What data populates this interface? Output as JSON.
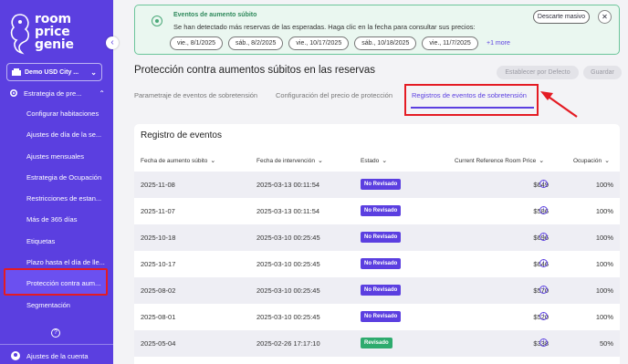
{
  "brand": {
    "logo_text": [
      "room",
      "price",
      "genie"
    ],
    "accent": "#5b3fe0",
    "highlight": "#e41b23"
  },
  "sidebar": {
    "hotel": "Demo USD City ...",
    "parent": "Estrategia de pre...",
    "items": [
      "Configurar habitaciones",
      "Ajustes de día de la se...",
      "Ajustes mensuales",
      "Estrategia de Ocupación",
      "Restricciones de estan...",
      "Más de 365 días",
      "Etiquetas",
      "Plazo hasta el día de lle...",
      "Protección contra aum...",
      "Segmentación"
    ],
    "help": "?",
    "account": "Ajustes de la cuenta"
  },
  "alert": {
    "title": "Eventos de aumento súbito",
    "text": "Se han detectado más reservas de las esperadas. Haga clic en la fecha para consultar sus precios:",
    "dates": [
      "vie., 8/1/2025",
      "sáb., 8/2/2025",
      "vie., 10/17/2025",
      "sáb., 10/18/2025",
      "vie., 11/7/2025"
    ],
    "more": "+1 more",
    "dismiss": "Descarte masivo",
    "close": "✕"
  },
  "header": {
    "title": "Protección contra aumentos súbitos en las reservas",
    "default_btn": "Establecer por Defecto",
    "save_btn": "Guardar"
  },
  "tabs": [
    "Parametraje de eventos de sobretensión",
    "Configuración del precio de protección",
    "Registros de eventos de sobretensión"
  ],
  "table": {
    "title": "Registro de eventos",
    "columns": [
      "Fecha de aumento súbito",
      "Fecha de intervención",
      "Estado",
      "Current Reference Room Price",
      "Ocupación"
    ],
    "rows": [
      {
        "surge": "2025-11-08",
        "intervention": "2025-03-13 00:11:54",
        "status": "No Revisado",
        "price": "$649",
        "occupancy": "100%"
      },
      {
        "surge": "2025-11-07",
        "intervention": "2025-03-13 00:11:54",
        "status": "No Revisado",
        "price": "$586",
        "occupancy": "100%"
      },
      {
        "surge": "2025-10-18",
        "intervention": "2025-03-10 00:25:45",
        "status": "No Revisado",
        "price": "$696",
        "occupancy": "100%"
      },
      {
        "surge": "2025-10-17",
        "intervention": "2025-03-10 00:25:45",
        "status": "No Revisado",
        "price": "$646",
        "occupancy": "100%"
      },
      {
        "surge": "2025-08-02",
        "intervention": "2025-03-10 00:25:45",
        "status": "No Revisado",
        "price": "$570",
        "occupancy": "100%"
      },
      {
        "surge": "2025-08-01",
        "intervention": "2025-03-10 00:25:45",
        "status": "No Revisado",
        "price": "$520",
        "occupancy": "100%"
      },
      {
        "surge": "2025-05-04",
        "intervention": "2025-02-26 17:17:10",
        "status": "Revisado",
        "price": "$338",
        "occupancy": "50%"
      }
    ]
  }
}
